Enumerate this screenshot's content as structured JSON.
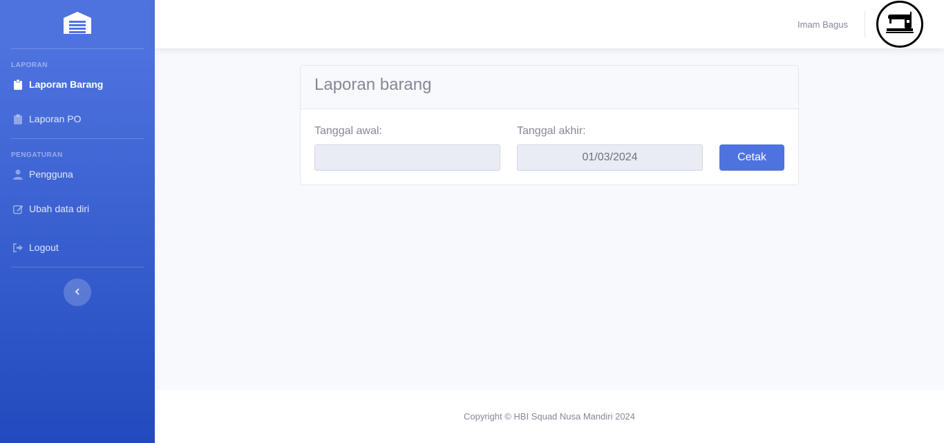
{
  "sidebar": {
    "brand_icon": "warehouse-icon",
    "sections": [
      {
        "heading": "LAPORAN"
      },
      {
        "heading": "PENGATURAN"
      }
    ],
    "items": [
      {
        "label": "Laporan Barang",
        "icon": "clipboard-icon",
        "active": true
      },
      {
        "label": "Laporan PO",
        "icon": "clipboard-icon",
        "active": false
      },
      {
        "label": "Pengguna",
        "icon": "user-icon",
        "active": false
      },
      {
        "label": "Ubah data diri",
        "icon": "edit-icon",
        "active": false
      },
      {
        "label": "Logout",
        "icon": "sign-out-icon",
        "active": false
      }
    ],
    "toggle_icon": "chevron-left-icon"
  },
  "topbar": {
    "user_name": "Imam Bagus",
    "avatar_icon": "sewing-machine-icon"
  },
  "card": {
    "title": "Laporan barang",
    "start_label": "Tanggal awal:",
    "start_value": "",
    "end_label": "Tanggal akhir:",
    "end_value": "01/03/2024",
    "print_label": "Cetak"
  },
  "footer": {
    "copyright": "Copyright © HBI Squad Nusa Mandiri 2024"
  },
  "colors": {
    "primary": "#4e73df",
    "sidebar_bottom": "#224abe",
    "text_muted": "#858796",
    "background": "#f8f9fc"
  }
}
